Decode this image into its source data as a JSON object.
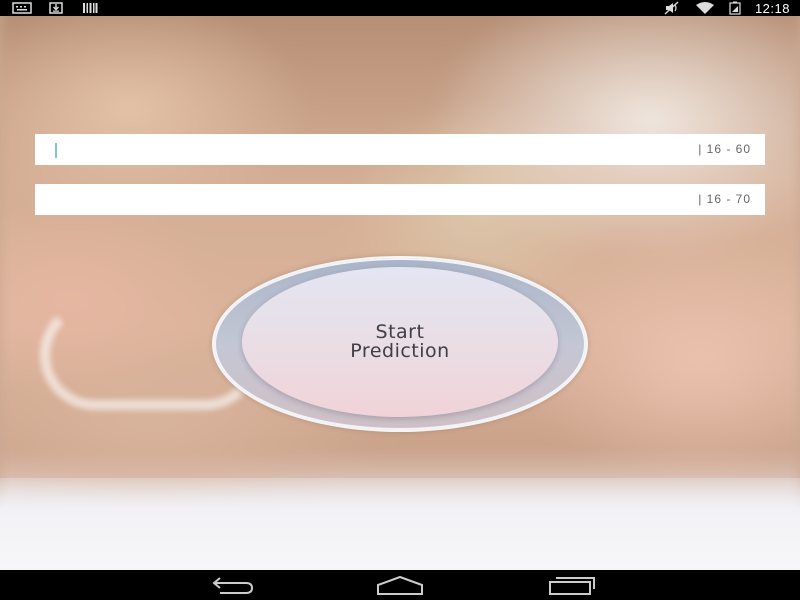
{
  "status_bar": {
    "time": "12:18",
    "left_icons": [
      "keyboard-icon",
      "download-icon",
      "barcode-icon"
    ],
    "right_icons": [
      "mute-icon",
      "wifi-icon",
      "battery-icon"
    ]
  },
  "form": {
    "field1": {
      "value": "",
      "range_hint": "| 16 - 60"
    },
    "field2": {
      "value": "",
      "range_hint": "| 16 - 70"
    }
  },
  "start_button": {
    "line1": "Start",
    "line2": "Prediction"
  },
  "nav_bar": {
    "buttons": [
      "back-icon",
      "home-icon",
      "recents-icon"
    ]
  },
  "colors": {
    "cursor": "#7ec8c8",
    "button_top": "#e3e6f2",
    "button_bottom": "#f0d3d8"
  }
}
